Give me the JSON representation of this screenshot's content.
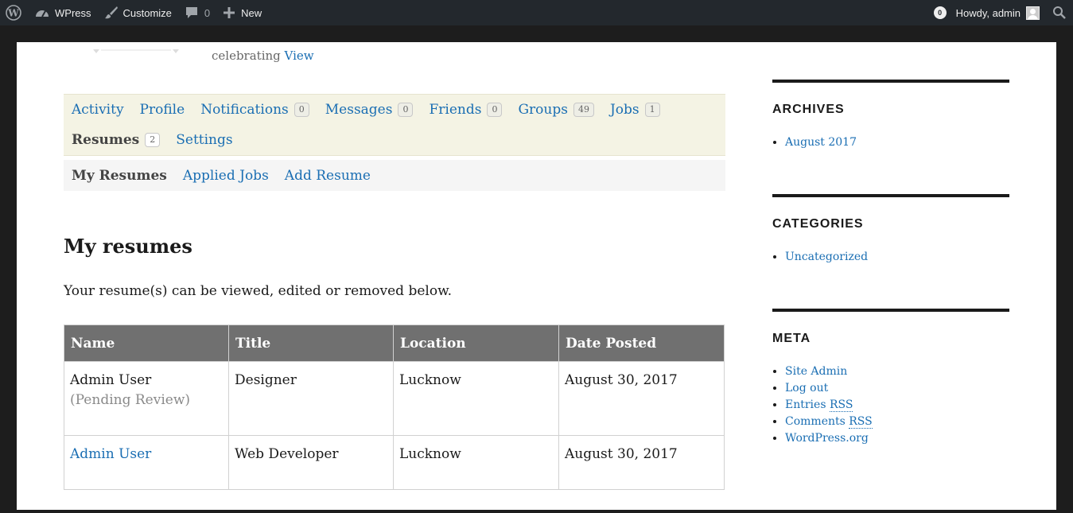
{
  "adminbar": {
    "site_name": "WPress",
    "customize": "Customize",
    "comments_count": "0",
    "new": "New",
    "notifications_count": "0",
    "howdy": "Howdy, admin"
  },
  "header": {
    "celebrating": "celebrating",
    "view_link": "View"
  },
  "profile_nav": {
    "items": [
      {
        "label": "Activity"
      },
      {
        "label": "Profile"
      },
      {
        "label": "Notifications",
        "count": "0"
      },
      {
        "label": "Messages",
        "count": "0"
      },
      {
        "label": "Friends",
        "count": "0"
      },
      {
        "label": "Groups",
        "count": "49"
      },
      {
        "label": "Jobs",
        "count": "1"
      },
      {
        "label": "Resumes",
        "count": "2"
      },
      {
        "label": "Settings"
      }
    ]
  },
  "sub_nav": {
    "items": [
      {
        "label": "My Resumes"
      },
      {
        "label": "Applied Jobs"
      },
      {
        "label": "Add Resume"
      }
    ]
  },
  "main": {
    "heading": "My resumes",
    "intro": "Your resume(s) can be viewed, edited or removed below."
  },
  "table": {
    "headers": [
      "Name",
      "Title",
      "Location",
      "Date Posted"
    ],
    "rows": [
      {
        "name": "Admin User",
        "status": "(Pending Review)",
        "title": "Designer",
        "location": "Lucknow",
        "date": "August 30, 2017"
      },
      {
        "name": "Admin User",
        "title": "Web Developer",
        "location": "Lucknow",
        "date": "August 30, 2017"
      }
    ]
  },
  "sidebar": {
    "archives": {
      "title": "ARCHIVES",
      "items": [
        "August 2017"
      ]
    },
    "categories": {
      "title": "CATEGORIES",
      "items": [
        "Uncategorized"
      ]
    },
    "meta": {
      "title": "META",
      "site_admin": "Site Admin",
      "log_out": "Log out",
      "entries": "Entries",
      "comments": "Comments",
      "rss": "RSS",
      "wordpress_org": "WordPress.org"
    }
  },
  "colors": {
    "link": "#1a6eb3",
    "adminbar_bg": "#23282d",
    "nav_bg": "#f4f3e4",
    "table_header_bg": "#707070"
  }
}
